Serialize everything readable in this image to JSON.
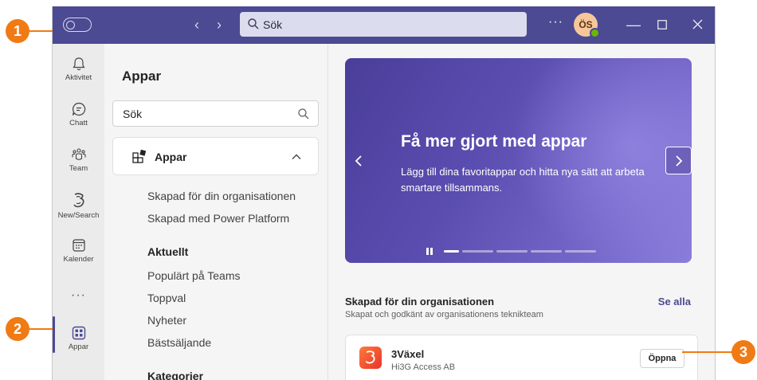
{
  "titlebar": {
    "search_placeholder": "Sök",
    "more_label": "···",
    "avatar_initials": "ÖS"
  },
  "rail": {
    "items": [
      {
        "label": "Aktivitet",
        "icon": "bell-icon"
      },
      {
        "label": "Chatt",
        "icon": "chat-icon"
      },
      {
        "label": "Team",
        "icon": "team-icon"
      },
      {
        "label": "New/Search",
        "icon": "three-logo-icon"
      },
      {
        "label": "Kalender",
        "icon": "calendar-icon"
      },
      {
        "label": "Appar",
        "icon": "apps-grid-icon"
      }
    ],
    "more_label": "···",
    "active_item": "Appar"
  },
  "apps_panel": {
    "title": "Appar",
    "search_placeholder": "Sök",
    "section_label": "Appar",
    "links_top": [
      "Skapad för din organisationen",
      "Skapad med Power Platform"
    ],
    "current_heading": "Aktuellt",
    "links_current": [
      "Populärt på Teams",
      "Toppval",
      "Nyheter",
      "Bästsäljande"
    ],
    "categories_heading": "Kategorier"
  },
  "banner": {
    "title": "Få mer gjort med appar",
    "text": "Lägg till dina favoritappar och hitta nya sätt att arbeta smartare tillsammans.",
    "slide_count": 5,
    "active_slide": 1
  },
  "org_section": {
    "title": "Skapad för din organisationen",
    "subtitle": "Skapat och godkänt av organisationens teknikteam",
    "see_all": "Se alla"
  },
  "app": {
    "name": "3Växel",
    "publisher": "Hi3G Access AB",
    "open_label": "Öppna"
  },
  "callouts": [
    "1",
    "2",
    "3"
  ],
  "colors": {
    "brand": "#4b4a92",
    "callout": "#f07a14",
    "status_available": "#6bb700"
  }
}
